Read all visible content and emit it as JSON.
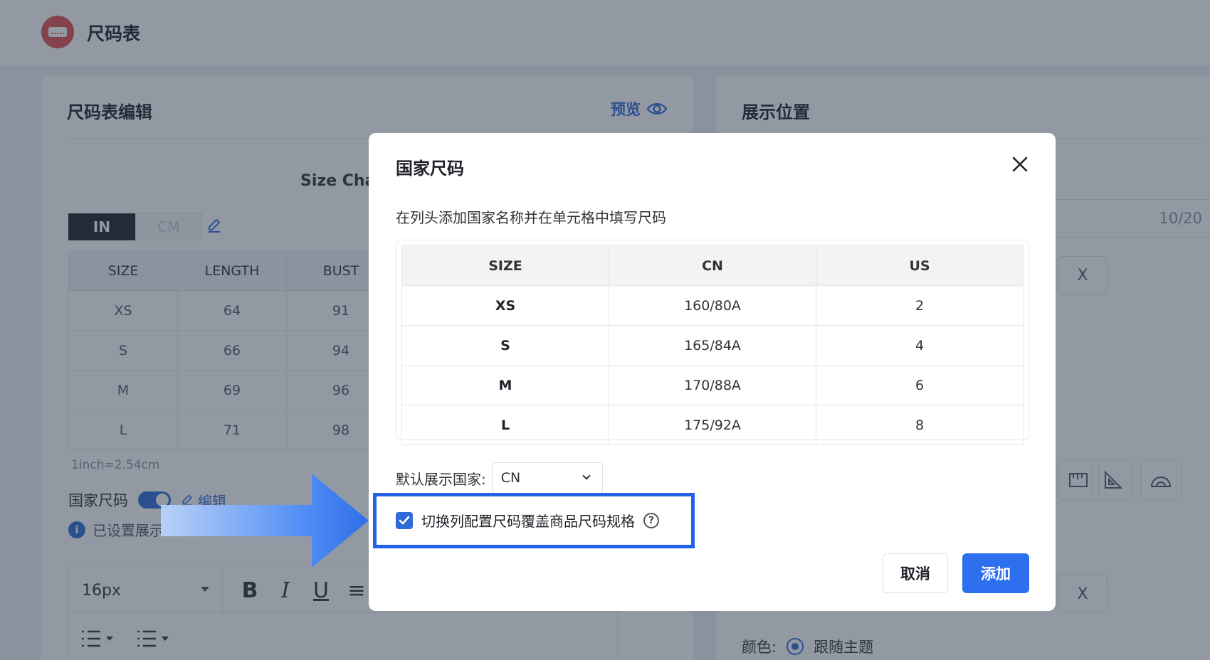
{
  "app": {
    "title": "尺码表"
  },
  "editor_card": {
    "title": "尺码表编辑",
    "preview_label": "预览",
    "chart_title": "Size Char",
    "units": [
      "IN",
      "CM"
    ],
    "table": {
      "headers": [
        "SIZE",
        "LENGTH",
        "BUST"
      ],
      "rows": [
        [
          "XS",
          "64",
          "91"
        ],
        [
          "S",
          "66",
          "94"
        ],
        [
          "M",
          "69",
          "96"
        ],
        [
          "L",
          "71",
          "98"
        ]
      ]
    },
    "note": "1inch=2.54cm",
    "country_size_label": "国家尺码",
    "edit_label": "编辑",
    "info_text": "已设置展示",
    "font_size": "16px"
  },
  "display_card": {
    "title": "展示位置",
    "counter": "10/20",
    "x_label": "X",
    "color_label": "颜色:",
    "color_option": "跟随主题"
  },
  "modal": {
    "title": "国家尺码",
    "description": "在列头添加国家名称并在单元格中填写尺码",
    "table": {
      "headers": [
        "SIZE",
        "CN",
        "US"
      ],
      "rows": [
        [
          "XS",
          "160/80A",
          "2"
        ],
        [
          "S",
          "165/84A",
          "4"
        ],
        [
          "M",
          "170/88A",
          "6"
        ],
        [
          "L",
          "175/92A",
          "8"
        ]
      ]
    },
    "default_country_label": "默认展示国家:",
    "default_country_value": "CN",
    "checkbox_label": "切换列配置尺码覆盖商品尺码规格",
    "checkbox_checked": true,
    "cancel_label": "取消",
    "add_label": "添加"
  },
  "colors": {
    "accent": "#2e6ff0",
    "highlight_border": "#2162e8",
    "logo": "#e0524f"
  }
}
